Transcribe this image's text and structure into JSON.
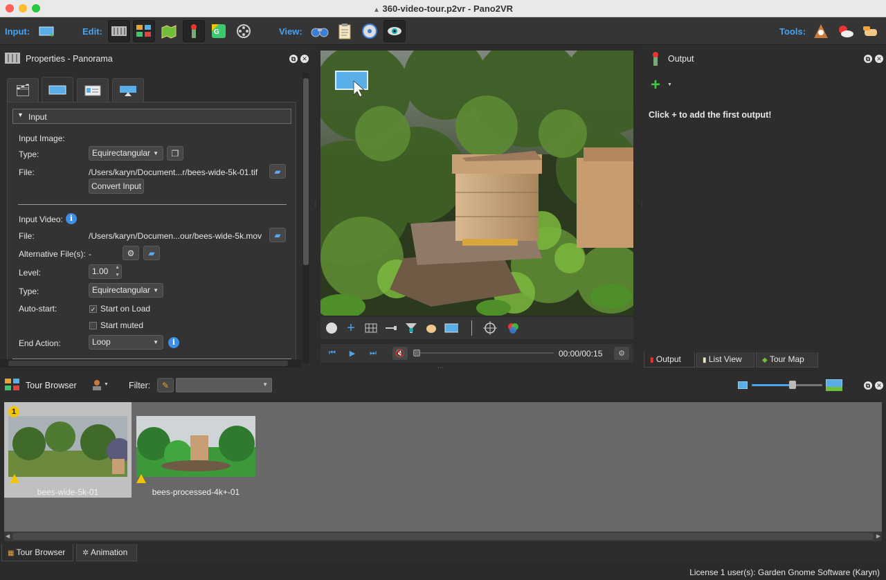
{
  "window": {
    "title": "360-video-tour.p2vr - Pano2VR"
  },
  "toolbar": {
    "input_label": "Input:",
    "edit_label": "Edit:",
    "view_label": "View:",
    "tools_label": "Tools:"
  },
  "properties": {
    "title": "Properties - Panorama",
    "section_title": "Input",
    "input_image_label": "Input Image:",
    "type_label": "Type:",
    "type_value": "Equirectangular",
    "file_label": "File:",
    "image_file": "/Users/karyn/Document...r/bees-wide-5k-01.tif",
    "convert_label": "Convert Input",
    "input_video_label": "Input Video:",
    "video_file_label": "File:",
    "video_file": "/Users/karyn/Documen...our/bees-wide-5k.mov",
    "alt_files_label": "Alternative File(s):",
    "alt_files_value": "-",
    "level_label": "Level:",
    "level_value": "1.00",
    "video_type_label": "Type:",
    "video_type_value": "Equirectangular",
    "autostart_label": "Auto-start:",
    "start_on_load": "Start on Load",
    "start_muted": "Start muted",
    "end_action_label": "End Action:",
    "end_action_value": "Loop"
  },
  "player": {
    "time": "00:00/00:15"
  },
  "output": {
    "title": "Output",
    "empty_message": "Click + to add the first output!",
    "tabs": [
      "Output",
      "List View",
      "Tour Map"
    ]
  },
  "tour_browser": {
    "title": "Tour Browser",
    "filter_label": "Filter:",
    "filter_value": "",
    "items": [
      {
        "badge": "1",
        "name": "bees-wide-5k-01"
      },
      {
        "name": "bees-processed-4k+-01"
      }
    ]
  },
  "bottom_tabs": [
    "Tour Browser",
    "Animation"
  ],
  "status": {
    "license": "License 1 user(s): Garden Gnome Software (Karyn)"
  },
  "colors": {
    "accent": "#4aa3ee",
    "panel": "#2d2d2d",
    "warning": "#f2c500"
  }
}
